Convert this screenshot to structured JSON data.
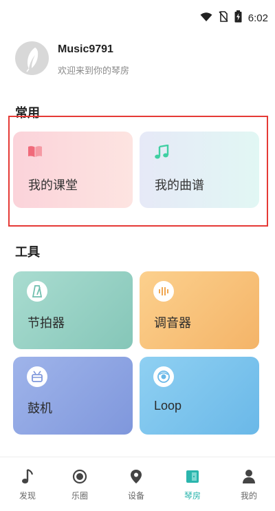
{
  "status_bar": {
    "time": "6:02",
    "icons": [
      "wifi-icon",
      "no-sim-icon",
      "battery-charging-icon"
    ]
  },
  "profile": {
    "username": "Music9791",
    "welcome": "欢迎来到你的琴房"
  },
  "common": {
    "title": "常用",
    "items": [
      {
        "label": "我的课堂",
        "icon": "book-icon",
        "icon_color": "#f06a7a"
      },
      {
        "label": "我的曲谱",
        "icon": "music-note-icon",
        "icon_color": "#3fcfa2"
      }
    ]
  },
  "tools": {
    "title": "工具",
    "items": [
      {
        "label": "节拍器",
        "icon": "metronome-icon",
        "color": "#8fcfc1"
      },
      {
        "label": "调音器",
        "icon": "tuner-icon",
        "color": "#f8c27a"
      },
      {
        "label": "鼓机",
        "icon": "drum-icon",
        "color": "#8ea6e2"
      },
      {
        "label": "Loop",
        "icon": "loop-icon",
        "color": "#7fc6ee"
      }
    ]
  },
  "bottom_nav": {
    "items": [
      {
        "label": "发现",
        "icon": "music-note-icon"
      },
      {
        "label": "乐圈",
        "icon": "circle-target-icon"
      },
      {
        "label": "设备",
        "icon": "location-pin-icon"
      },
      {
        "label": "琴房",
        "icon": "door-icon",
        "active": true
      },
      {
        "label": "我的",
        "icon": "person-icon"
      }
    ],
    "active_color": "#2bb5ad"
  }
}
